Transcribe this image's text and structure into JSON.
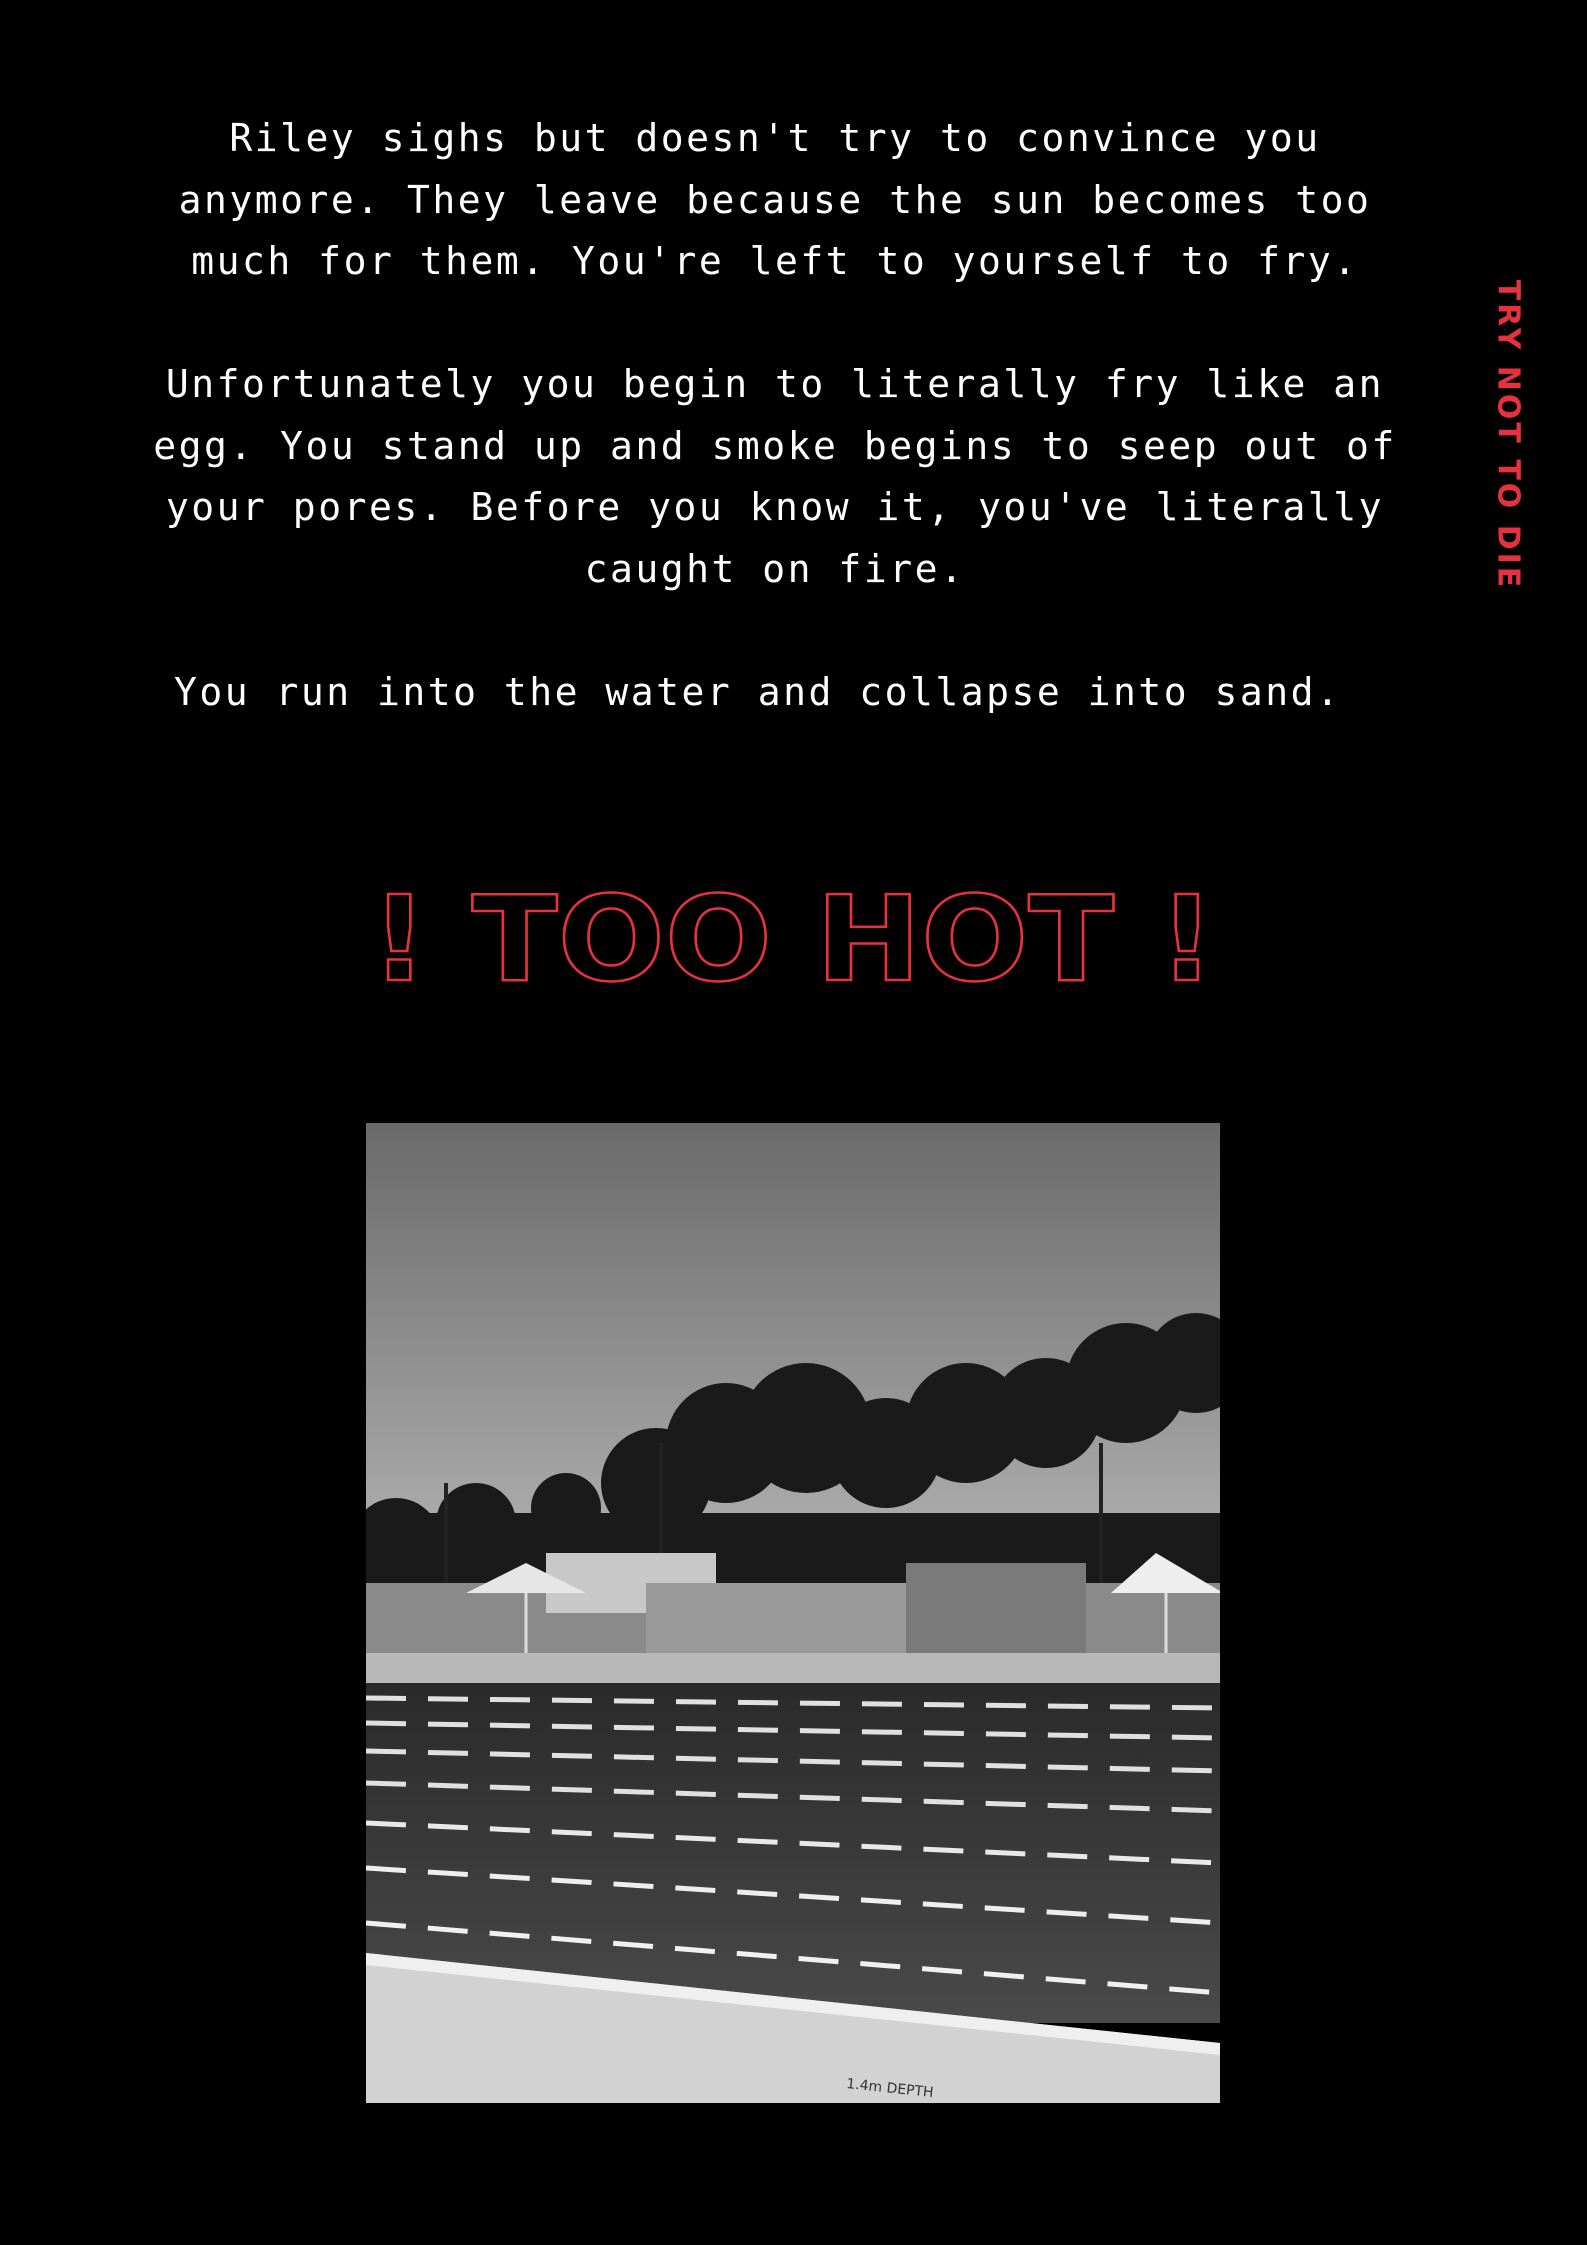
{
  "story": {
    "paragraphs": [
      "Riley sighs but doesn't try to convince you anymore. They leave because the sun becomes too much for them. You're left to yourself to fry.",
      "Unfortunately you begin to literally fry like an egg. You stand up and smoke begins to seep out of your pores. Before you know it, you've literally caught on fire.",
      "You run into the water and collapse into sand."
    ]
  },
  "side_title": "TRY NOT TO DIE",
  "headline": "! TOO HOT !",
  "photo": {
    "depth_marking": "1.4m DEPTH"
  },
  "colors": {
    "background": "#000000",
    "text": "#ffffff",
    "accent_red": "#e5323e"
  }
}
